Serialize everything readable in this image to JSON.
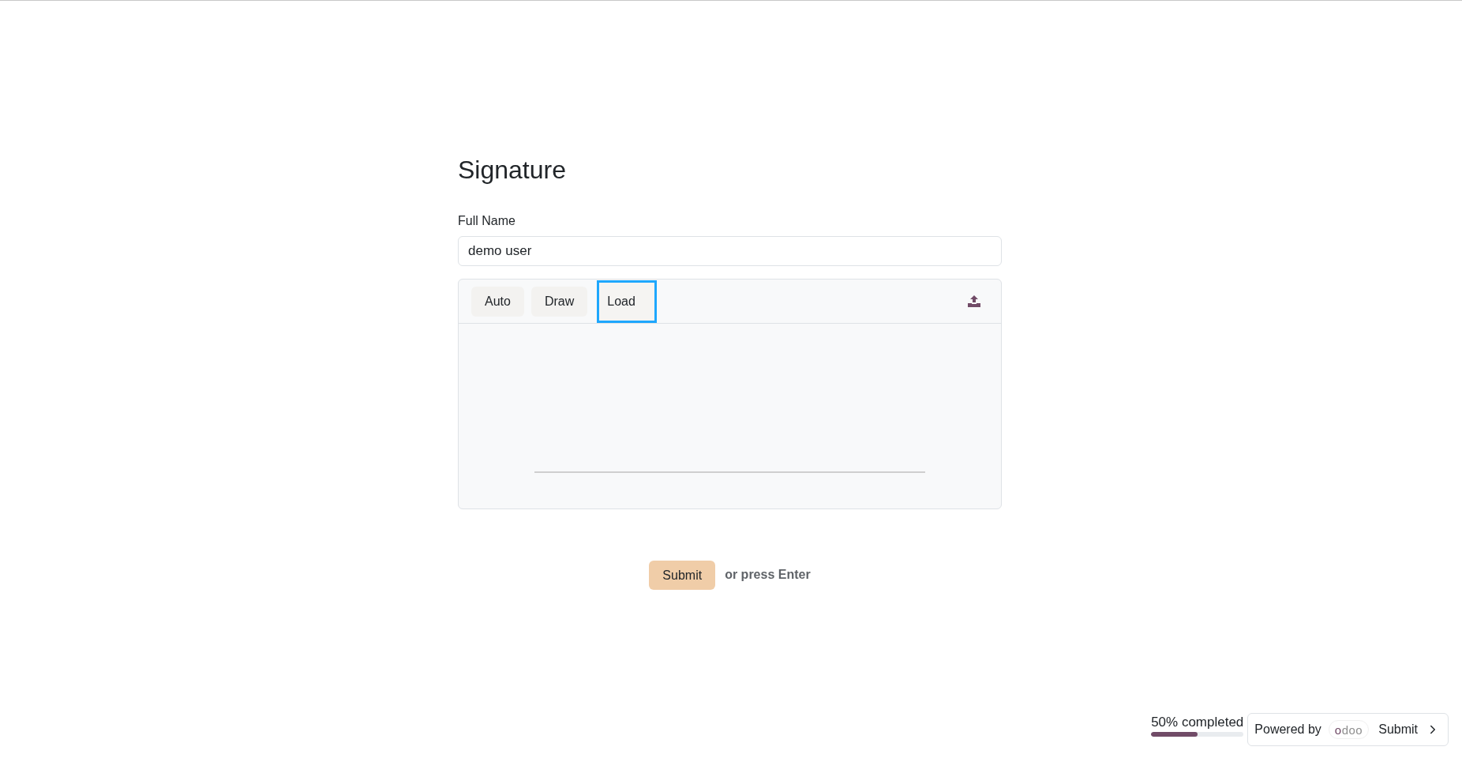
{
  "title": "Signature",
  "full_name": {
    "label": "Full Name",
    "value": "demo user"
  },
  "signature_pad": {
    "tabs": [
      {
        "label": "Auto",
        "selected": false
      },
      {
        "label": "Draw",
        "selected": false
      },
      {
        "label": "Load",
        "selected": true
      }
    ]
  },
  "submit": {
    "button": "Submit",
    "hint": "or press Enter"
  },
  "footer": {
    "progress": {
      "label": "50% completed",
      "level": 0.5
    },
    "powered_by": "Powered by",
    "logo": "odoo",
    "next_button": "Submit"
  }
}
